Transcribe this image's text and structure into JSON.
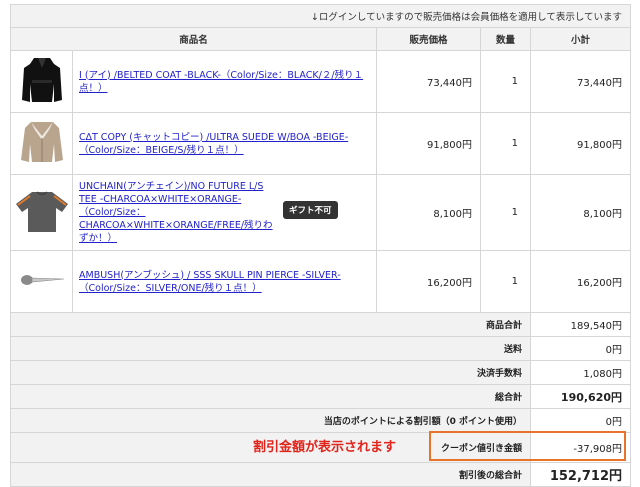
{
  "notice": "↓ログインしていますので販売価格は会員価格を適用して表示しています",
  "headers": {
    "name": "商品名",
    "price": "販売価格",
    "qty": "数量",
    "subtotal": "小計"
  },
  "items": [
    {
      "name": "I (アイ) /BELTED COAT -BLACK-（Color/Size：BLACK/２/残り１点！）",
      "price": "73,440円",
      "qty": "1",
      "subtotal": "73,440円",
      "image": "black-coat"
    },
    {
      "name": "C∆T COPY (キャットコピー) /ULTRA SUEDE W/BOA -BEIGE-（Color/Size：BEIGE/S/残り１点！）",
      "price": "91,800円",
      "qty": "1",
      "subtotal": "91,800円",
      "image": "beige-jacket"
    },
    {
      "name": "UNCHAIN(アンチェイン)/NO FUTURE L/S TEE -CHARCOA×WHITE×ORANGE-（Color/Size：CHARCOA×WHITE×ORANGE/FREE/残りわずか！）",
      "price": "8,100円",
      "qty": "1",
      "subtotal": "8,100円",
      "badge": "ギフト不可",
      "image": "grey-tee"
    },
    {
      "name": "AMBUSH(アンブッシュ) / SSS SKULL PIN PIERCE -SILVER-（Color/Size：SILVER/ONE/残り１点！）",
      "price": "16,200円",
      "qty": "1",
      "subtotal": "16,200円",
      "image": "silver-pin"
    }
  ],
  "summary": {
    "goods_total_label": "商品合計",
    "goods_total": "189,540円",
    "shipping_label": "送料",
    "shipping": "0円",
    "fee_label": "決済手数料",
    "fee": "1,080円",
    "total_label": "総合計",
    "total": "190,620円",
    "points_label": "当店のポイントによる割引額（0 ポイント使用）",
    "points": "0円",
    "coupon_label": "クーポン値引き金額",
    "coupon": "-37,908円",
    "final_label": "割引後の総合計",
    "final": "152,712円"
  },
  "annotation": "割引金額が表示されます",
  "colors": {
    "annotation": "#e2231a",
    "highlight_border": "#e8732a",
    "link": "#2222cc",
    "header_bg": "#f2f2f2"
  }
}
